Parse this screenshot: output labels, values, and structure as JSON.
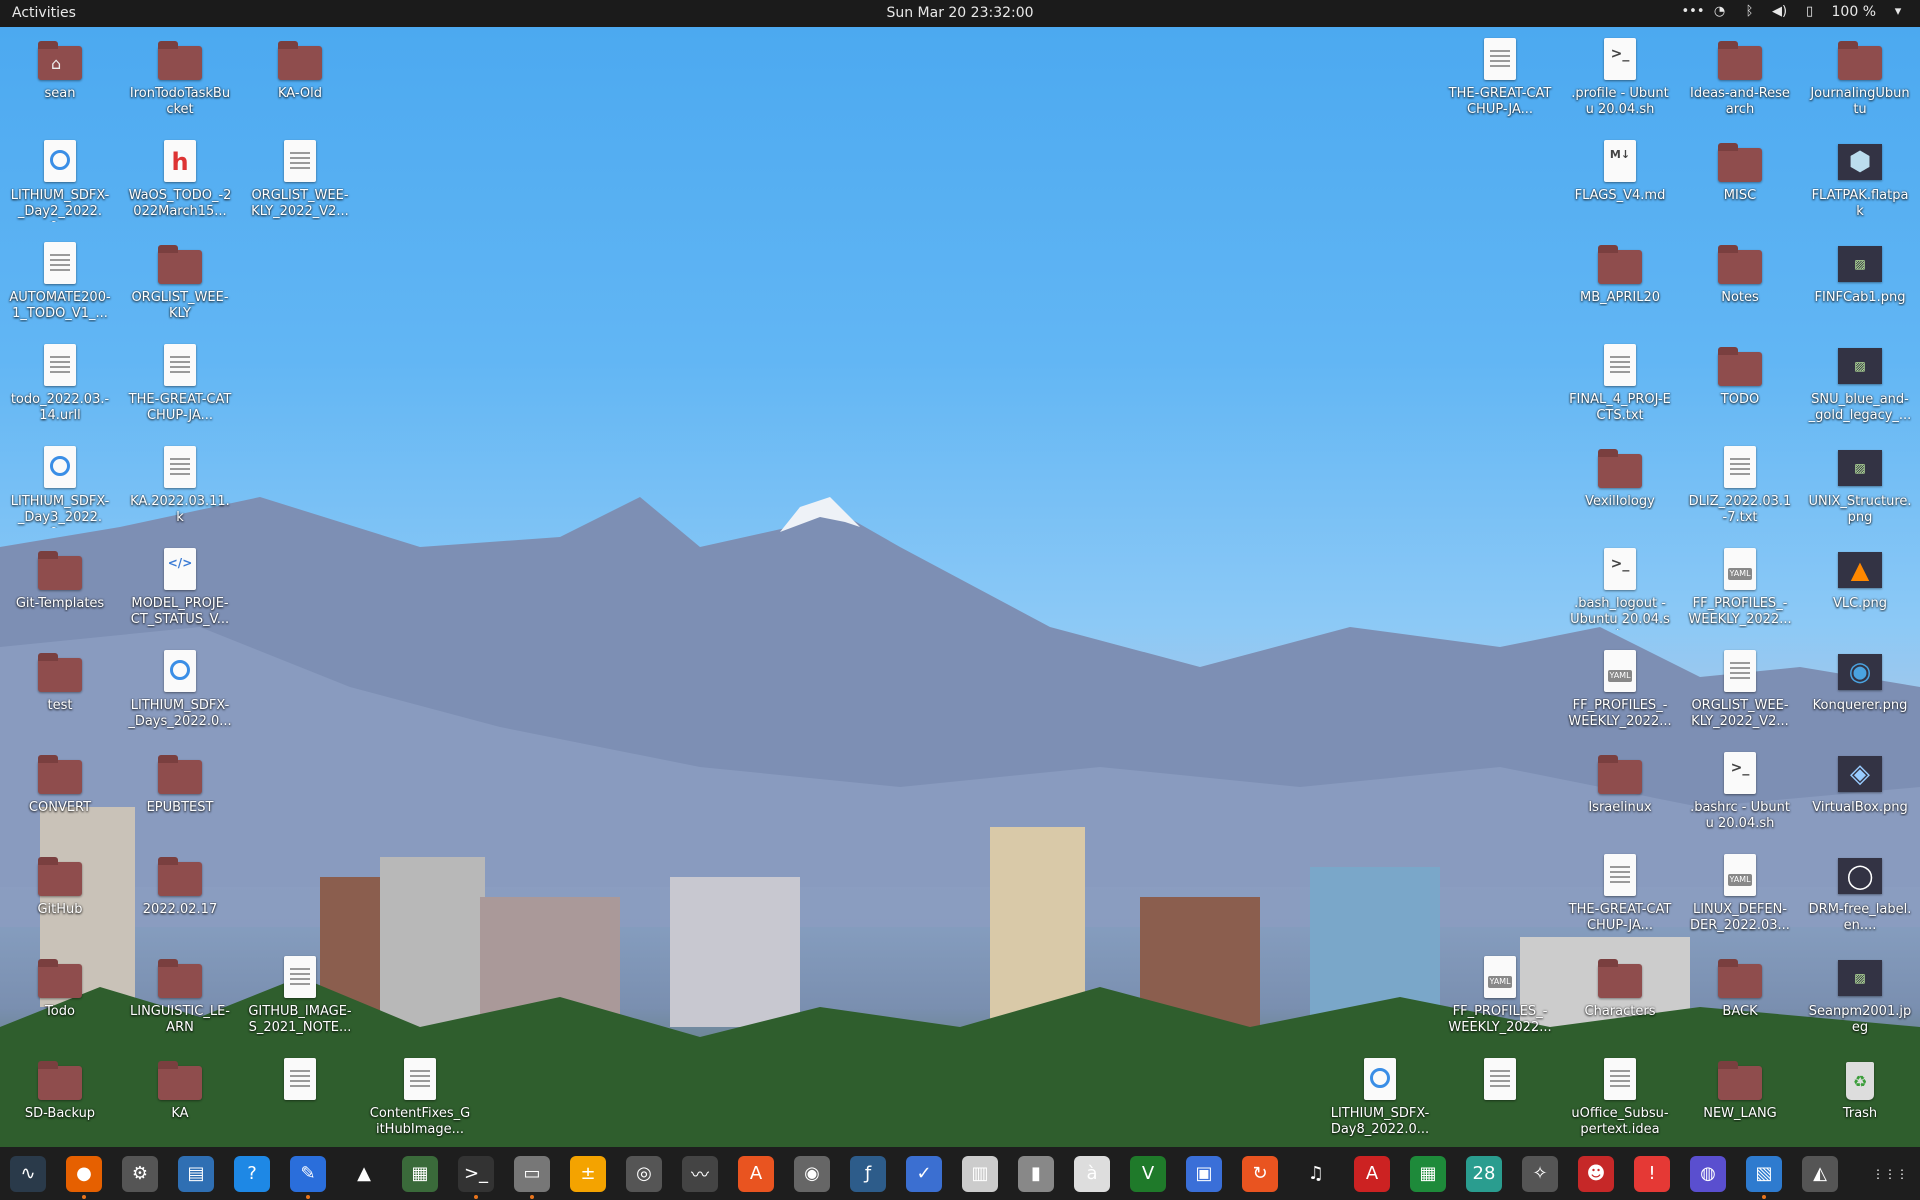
{
  "topbar": {
    "activities": "Activities",
    "clock": "Sun Mar 20  23:32:00",
    "battery": "100 %",
    "tray_icons": [
      "more-icon",
      "wifi-icon",
      "bluetooth-icon",
      "volume-icon",
      "battery-icon",
      "chevron-down-icon"
    ]
  },
  "desktop": {
    "left": [
      {
        "label": "sean",
        "type": "home"
      },
      {
        "label": "IronTodoTaskBucket",
        "type": "folder"
      },
      {
        "label": "KA-Old",
        "type": "folder"
      },
      {
        "label": "LITHIUM_SDFX-_Day2_2022.0...",
        "type": "lit"
      },
      {
        "label": "WaOS_TODO_-2022March15...",
        "type": "h"
      },
      {
        "label": "ORGLIST_WEE-KLY_2022_V2...",
        "type": "doc"
      },
      {
        "label": "AUTOMATE200-1_TODO_V1_...",
        "type": "doc"
      },
      {
        "label": "ORGLIST_WEE-KLY",
        "type": "folder"
      },
      {
        "label": "todo_2022.03.-14.urll",
        "type": "doc"
      },
      {
        "label": "THE-GREAT-CATCHUP-JA...",
        "type": "doc"
      },
      {
        "label": "LITHIUM_SDFX-_Day3_2022.0...",
        "type": "lit"
      },
      {
        "label": "KA.2022.03.11.k",
        "type": "doc"
      },
      {
        "label": "Git-Templates",
        "type": "folder"
      },
      {
        "label": "MODEL_PROJE-CT_STATUS_V...",
        "type": "html"
      },
      {
        "label": "test",
        "type": "folder"
      },
      {
        "label": "LITHIUM_SDFX-_Days_2022.0...",
        "type": "lit"
      },
      {
        "label": "CONVERT",
        "type": "folder"
      },
      {
        "label": "EPUBTEST",
        "type": "folder"
      },
      {
        "label": "GitHub",
        "type": "folder"
      },
      {
        "label": "2022.02.17",
        "type": "folder"
      },
      {
        "label": "Todo",
        "type": "folder"
      },
      {
        "label": "LINGUISTIC_LE-ARN",
        "type": "folder"
      },
      {
        "label": "GITHUB_IMAGE-S_2021_NOTE...",
        "type": "doc"
      },
      {
        "label": "SD-Backup",
        "type": "folder"
      },
      {
        "label": "KA",
        "type": "folder"
      },
      {
        "label": "",
        "type": "doc"
      },
      {
        "label": "ContentFixes_GitHubImage...",
        "type": "doc"
      }
    ],
    "right": [
      {
        "label": "THE-GREAT-CATCHUP-JA...",
        "type": "doc"
      },
      {
        "label": ".profile - Ubuntu 20.04.sh",
        "type": "term"
      },
      {
        "label": "Ideas-and-Research",
        "type": "folder"
      },
      {
        "label": "JournalingUbuntu",
        "type": "folder"
      },
      {
        "label": "FLAGS_V4.md",
        "type": "md"
      },
      {
        "label": "MISC",
        "type": "folder"
      },
      {
        "label": "FLATPAK.flatpak",
        "type": "flatpak"
      },
      {
        "label": "MB_APRIL20",
        "type": "folder"
      },
      {
        "label": "Notes",
        "type": "folder"
      },
      {
        "label": "FINFCab1.png",
        "type": "image"
      },
      {
        "label": "FINAL_4_PROJ-ECTS.txt",
        "type": "doc"
      },
      {
        "label": "TODO",
        "type": "folder"
      },
      {
        "label": "SNU_blue_and-_gold_legacy_...",
        "type": "image"
      },
      {
        "label": "Vexillology",
        "type": "folder"
      },
      {
        "label": "DLIZ_2022.03.1-7.txt",
        "type": "doc"
      },
      {
        "label": "UNIX_Structure.png",
        "type": "image"
      },
      {
        "label": ".bash_logout - Ubuntu 20.04.sh",
        "type": "term"
      },
      {
        "label": "FF_PROFILES_-WEEKLY_2022...",
        "type": "yaml"
      },
      {
        "label": "VLC.png",
        "type": "vlc"
      },
      {
        "label": "FF_PROFILES_-WEEKLY_2022...",
        "type": "yaml"
      },
      {
        "label": "ORGLIST_WEE-KLY_2022_V2...",
        "type": "doc"
      },
      {
        "label": "Konquerer.png",
        "type": "konq"
      },
      {
        "label": "Israelinux",
        "type": "folder"
      },
      {
        "label": ".bashrc - Ubuntu 20.04.sh",
        "type": "term"
      },
      {
        "label": "VirtualBox.png",
        "type": "vbox"
      },
      {
        "label": "THE-GREAT-CATCHUP-JA...",
        "type": "doc"
      },
      {
        "label": "LINUX_DEFEN-DER_2022.03...",
        "type": "yaml"
      },
      {
        "label": "DRM-free_label.en....",
        "type": "drm"
      },
      {
        "label": "FF_PROFILES_-WEEKLY_2022...",
        "type": "yaml"
      },
      {
        "label": "Characters",
        "type": "folder"
      },
      {
        "label": "BACK",
        "type": "folder"
      },
      {
        "label": "Seanpm2001.jpeg",
        "type": "image"
      },
      {
        "label": "LITHIUM_SDFX-Day8_2022.0...",
        "type": "lit"
      },
      {
        "label": "",
        "type": "doc"
      },
      {
        "label": "uOffice_Subsu-pertext.idea",
        "type": "doc"
      },
      {
        "label": "NEW_LANG",
        "type": "folder"
      },
      {
        "label": "Trash",
        "type": "trash"
      }
    ]
  },
  "dock": {
    "items": [
      {
        "name": "system-monitor-icon",
        "glyph": "∿",
        "bg": "#2a3a4a"
      },
      {
        "name": "firefox-icon",
        "glyph": "●",
        "bg": "#e66000"
      },
      {
        "name": "settings-icon",
        "glyph": "⚙",
        "bg": "#555"
      },
      {
        "name": "text-document-icon",
        "glyph": "▤",
        "bg": "#2f6fb3"
      },
      {
        "name": "help-icon",
        "glyph": "?",
        "bg": "#1e88e5"
      },
      {
        "name": "text-editor-icon",
        "glyph": "✎",
        "bg": "#2a6edb"
      },
      {
        "name": "vlc-icon",
        "glyph": "▲",
        "bg": "#1e1e1e"
      },
      {
        "name": "puzzle-icon",
        "glyph": "▦",
        "bg": "#3a6a3a"
      },
      {
        "name": "terminal-icon",
        "glyph": ">_",
        "bg": "#333"
      },
      {
        "name": "files-icon",
        "glyph": "▭",
        "bg": "#777"
      },
      {
        "name": "calculator-icon",
        "glyph": "±",
        "bg": "#f4a300"
      },
      {
        "name": "image-viewer-icon",
        "glyph": "◎",
        "bg": "#555"
      },
      {
        "name": "monitor-graph-icon",
        "glyph": "〰",
        "bg": "#444"
      },
      {
        "name": "software-store-icon",
        "glyph": "A",
        "bg": "#e95420"
      },
      {
        "name": "disc-icon",
        "glyph": "◉",
        "bg": "#666"
      },
      {
        "name": "fonts-icon",
        "glyph": "ƒ",
        "bg": "#2d5c8a"
      },
      {
        "name": "todo-icon",
        "glyph": "✓",
        "bg": "#3b6fd1"
      },
      {
        "name": "calendar-doc-icon",
        "glyph": "▥",
        "bg": "#ccc"
      },
      {
        "name": "archive-icon",
        "glyph": "▮",
        "bg": "#888"
      },
      {
        "name": "character-map-icon",
        "glyph": "à",
        "bg": "#ddd"
      },
      {
        "name": "vim-icon",
        "glyph": "V",
        "bg": "#1f7a2a"
      },
      {
        "name": "window-icon",
        "glyph": "▣",
        "bg": "#3a6fd8"
      },
      {
        "name": "update-icon",
        "glyph": "↻",
        "bg": "#e95420"
      },
      {
        "name": "music-icon",
        "glyph": "♫",
        "bg": "#1e1e1e"
      },
      {
        "name": "pdf-icon",
        "glyph": "A",
        "bg": "#cc2222"
      },
      {
        "name": "spreadsheet-icon",
        "glyph": "▦",
        "bg": "#1e8a3a"
      },
      {
        "name": "calendar-icon",
        "glyph": "28",
        "bg": "#2a9d8f"
      },
      {
        "name": "gimp-icon",
        "glyph": "✧",
        "bg": "#555"
      },
      {
        "name": "game-icon",
        "glyph": "☻",
        "bg": "#c62828"
      },
      {
        "name": "alert-icon",
        "glyph": "!",
        "bg": "#e53935"
      },
      {
        "name": "screenshot-icon",
        "glyph": "◍",
        "bg": "#5a4fcf"
      },
      {
        "name": "remote-desktop-icon",
        "glyph": "▧",
        "bg": "#2e7bcf"
      },
      {
        "name": "updates-icon",
        "glyph": "◭",
        "bg": "#555"
      }
    ],
    "apps_grid_icon": "⋮⋮⋮"
  }
}
